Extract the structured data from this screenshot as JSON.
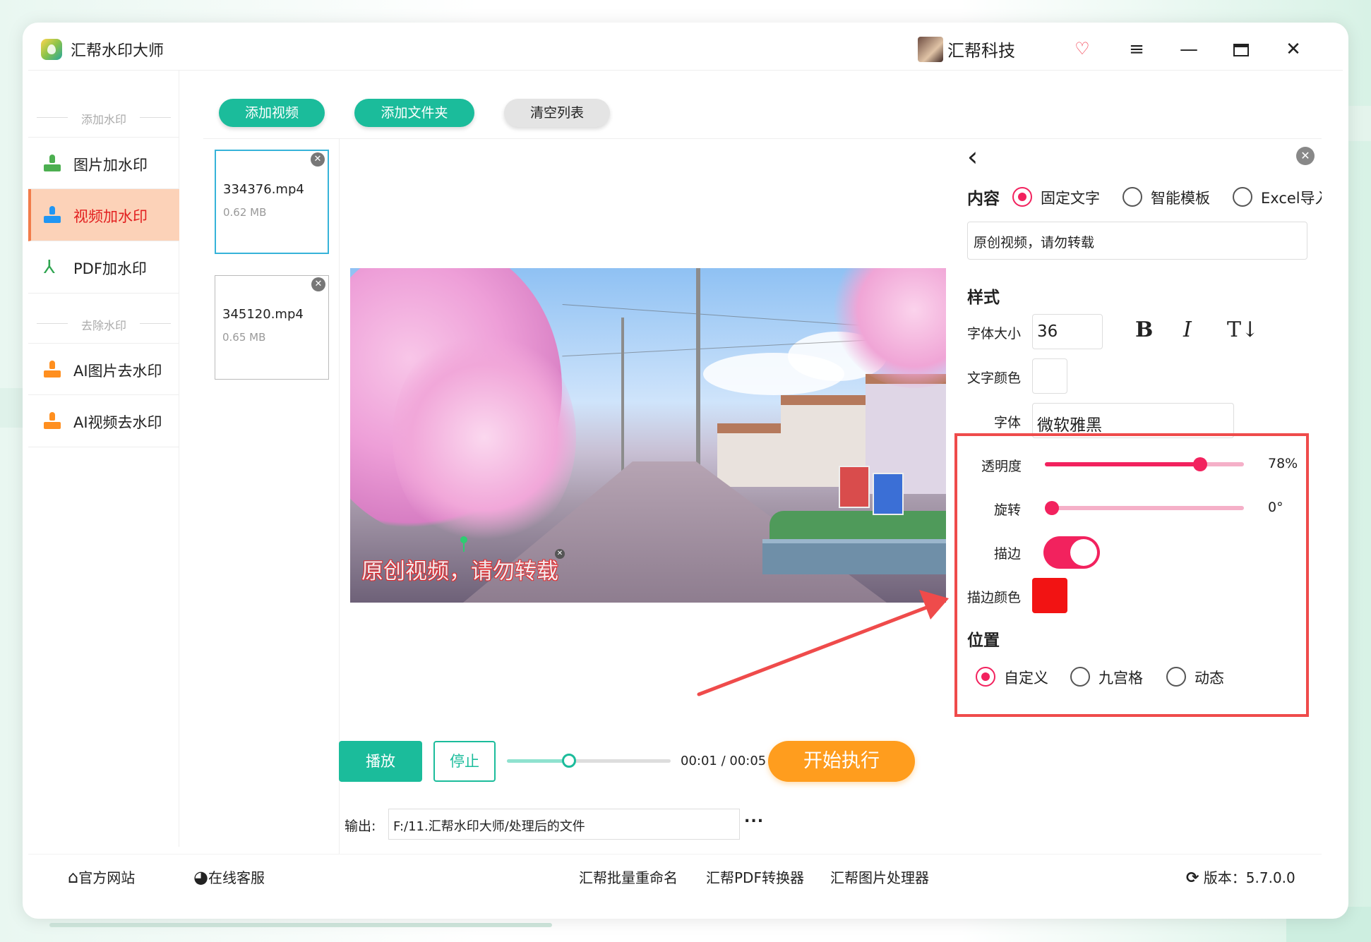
{
  "app": {
    "title": "汇帮水印大师"
  },
  "user": {
    "name": "汇帮科技"
  },
  "sidebar": {
    "section_add": "添加水印",
    "section_remove": "去除水印",
    "items": [
      {
        "label": "图片加水印"
      },
      {
        "label": "视频加水印"
      },
      {
        "label": "PDF加水印"
      },
      {
        "label": "AI图片去水印"
      },
      {
        "label": "AI视频去水印"
      }
    ]
  },
  "toolbar": {
    "add_video": "添加视频",
    "add_folder": "添加文件夹",
    "clear_list": "清空列表"
  },
  "files": [
    {
      "name": "334376.mp4",
      "size": "0.62 MB"
    },
    {
      "name": "345120.mp4",
      "size": "0.65 MB"
    }
  ],
  "preview": {
    "watermark_text": "原创视频，请勿转载"
  },
  "panel": {
    "content_title": "内容",
    "content_options": [
      "固定文字",
      "智能模板",
      "Excel导入"
    ],
    "text_value": "原创视频，请勿转载",
    "style_title": "样式",
    "font_size_label": "字体大小",
    "font_size_value": "36",
    "bold_label": "B",
    "italic_label": "I",
    "textdir_label": "T↓",
    "text_color_label": "文字颜色",
    "font_label": "字体",
    "font_value": "微软雅黑",
    "opacity_label": "透明度",
    "opacity_value": "78%",
    "rotate_label": "旋转",
    "rotate_value": "0°",
    "stroke_label": "描边",
    "stroke_color_label": "描边颜色",
    "position_title": "位置",
    "position_options": [
      "自定义",
      "九宫格",
      "动态"
    ]
  },
  "colors": {
    "accent": "#1bbc9b",
    "pink": "#f2225e",
    "orange": "#ff9d1e",
    "stroke_color": "#f21313",
    "text_color": "#ffffff"
  },
  "player": {
    "play": "播放",
    "stop": "停止",
    "time": "00:01 / 00:05",
    "progress": 0.38,
    "start": "开始执行"
  },
  "output": {
    "label": "输出:",
    "path": "F:/11.汇帮水印大师/处理后的文件",
    "more": "..."
  },
  "footer": {
    "website": "官方网站",
    "support": "在线客服",
    "tool1": "汇帮批量重命名",
    "tool2": "汇帮PDF转换器",
    "tool3": "汇帮图片处理器",
    "version": "版本：5.7.0.0"
  },
  "icons": [
    "app-logo-icon",
    "vip-icon",
    "menu-icon",
    "minimize-icon",
    "maximize-icon",
    "close-icon",
    "stamp-icon",
    "pdf-icon",
    "back-arrow-icon",
    "home-icon",
    "support-icon",
    "refresh-icon"
  ]
}
